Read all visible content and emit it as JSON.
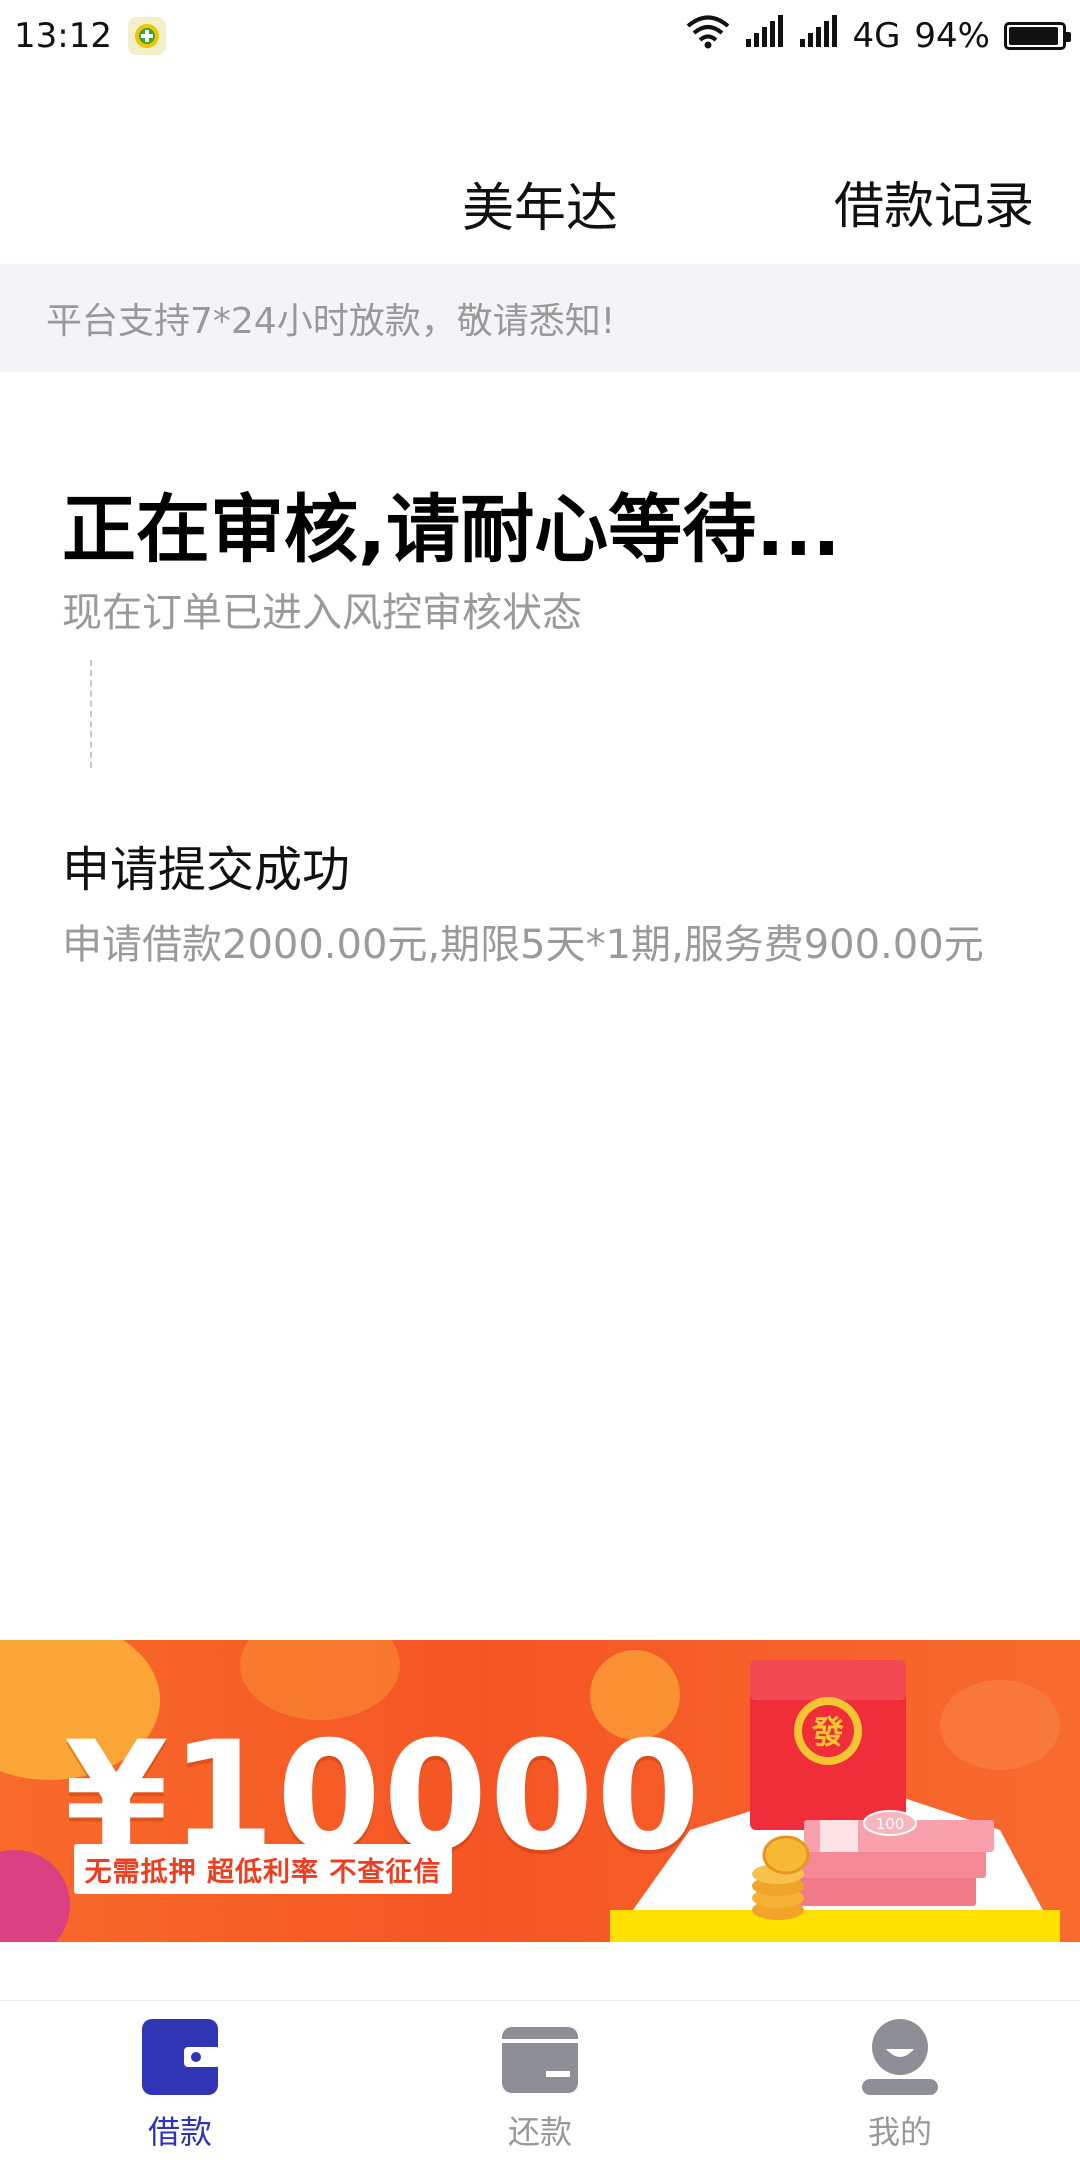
{
  "status_bar": {
    "time": "13:12",
    "network": "4G",
    "battery": "94%",
    "battery_level": 0.94
  },
  "header": {
    "title": "美年达",
    "action_label": "借款记录"
  },
  "notice": {
    "text": "平台支持7*24小时放款，敬请悉知!"
  },
  "status": {
    "title": "正在审核,请耐心等待...",
    "subtitle": "现在订单已进入风控审核状态"
  },
  "step": {
    "title": "申请提交成功",
    "description": "申请借款2000.00元,期限5天*1期,服务费900.00元"
  },
  "banner": {
    "amount": "¥10000",
    "tagline": "无需抵押  超低利率  不查征信",
    "envelope_char": "發",
    "note_value": "100"
  },
  "tabs": [
    {
      "label": "借款",
      "icon": "wallet-icon",
      "active": true
    },
    {
      "label": "还款",
      "icon": "card-icon",
      "active": false
    },
    {
      "label": "我的",
      "icon": "user-icon",
      "active": false
    }
  ],
  "colors": {
    "accent": "#2f35b4",
    "banner": "#f55524",
    "inactive": "#999999"
  }
}
